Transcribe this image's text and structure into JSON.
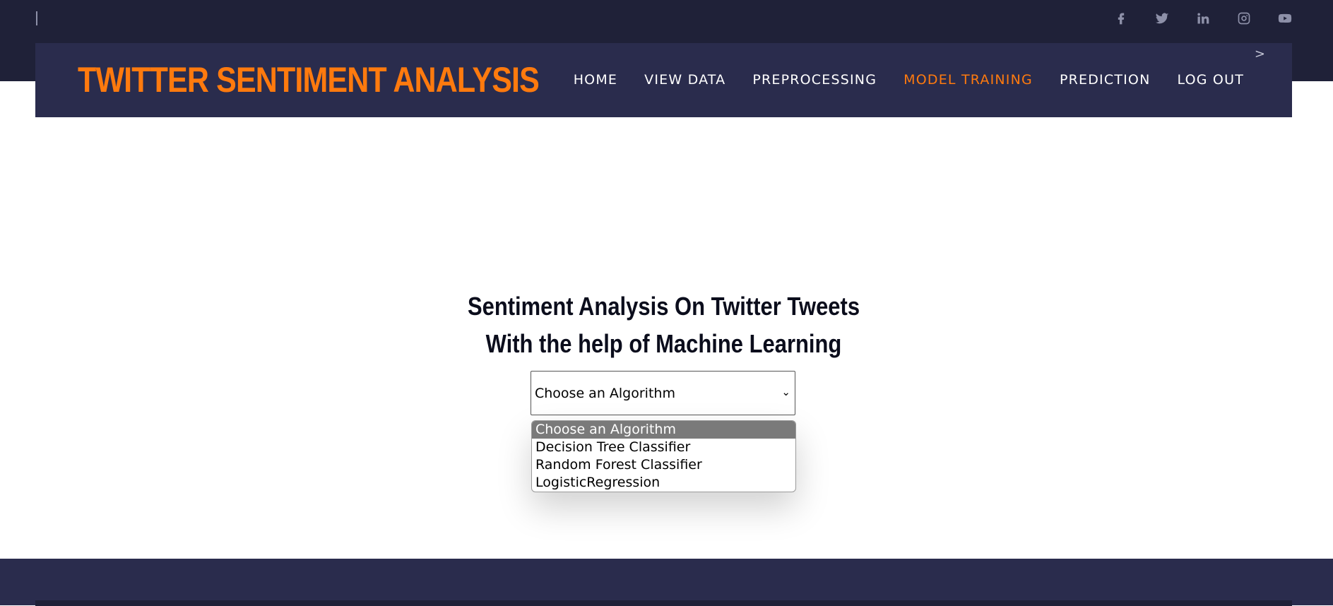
{
  "social": [
    {
      "icon": "facebook-icon"
    },
    {
      "icon": "twitter-icon"
    },
    {
      "icon": "linkedin-icon"
    },
    {
      "icon": "instagram-icon"
    },
    {
      "icon": "youtube-icon"
    }
  ],
  "brand": {
    "title": "TWITTER SENTIMENT ANALYSIS",
    "color": "#ff7a0e"
  },
  "nav": {
    "items": [
      {
        "label": "HOME"
      },
      {
        "label": "VIEW DATA"
      },
      {
        "label": "PREPROCESSING"
      },
      {
        "label": "MODEL TRAINING",
        "active": true
      },
      {
        "label": "PREDICTION"
      },
      {
        "label": "LOG OUT"
      }
    ],
    "arrow": ">"
  },
  "main": {
    "heading_line1": "Sentiment Analysis On Twitter Tweets",
    "heading_line2": "With the help of Machine Learning"
  },
  "select": {
    "value": "Choose an Algorithm",
    "options": [
      {
        "label": "Choose an Algorithm",
        "selected": true
      },
      {
        "label": "Decision Tree Classifier"
      },
      {
        "label": "Random Forest Classifier"
      },
      {
        "label": "LogisticRegression"
      }
    ]
  },
  "colors": {
    "topbar": "#1f2138",
    "navbar": "#2a2c4d",
    "accent": "#ff7a0e"
  }
}
